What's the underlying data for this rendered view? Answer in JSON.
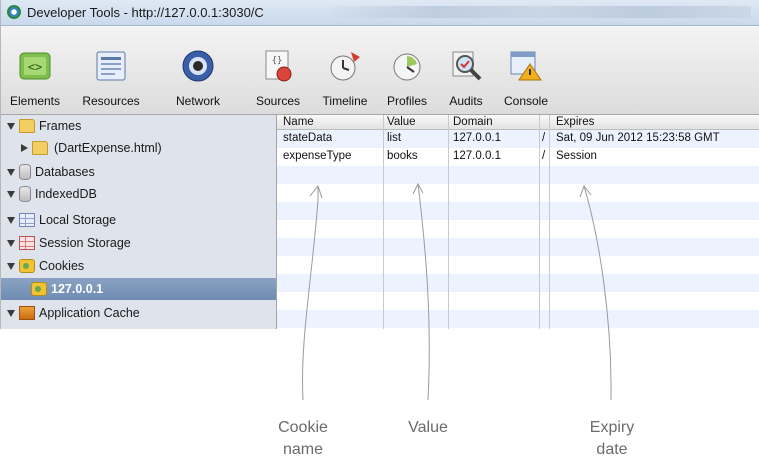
{
  "window": {
    "title": "Developer Tools - http://127.0.0.1:3030/C"
  },
  "toolbar": {
    "tabs": [
      {
        "label": "Elements",
        "icon": "elements-icon"
      },
      {
        "label": "Resources",
        "icon": "resources-icon"
      },
      {
        "label": "Network",
        "icon": "network-icon"
      },
      {
        "label": "Sources",
        "icon": "sources-icon"
      },
      {
        "label": "Timeline",
        "icon": "timeline-icon"
      },
      {
        "label": "Profiles",
        "icon": "profiles-icon"
      },
      {
        "label": "Audits",
        "icon": "audits-icon"
      },
      {
        "label": "Console",
        "icon": "console-icon"
      }
    ]
  },
  "sidebar": {
    "items": [
      {
        "label": "Frames",
        "icon": "folder-icon",
        "expanded": true
      },
      {
        "label": "(DartExpense.html)",
        "icon": "folder-icon",
        "expanded": false
      },
      {
        "label": "Databases",
        "icon": "database-icon",
        "expanded": true
      },
      {
        "label": "IndexedDB",
        "icon": "database-icon",
        "expanded": true
      },
      {
        "label": "Local Storage",
        "icon": "storage-icon",
        "expanded": true
      },
      {
        "label": "Session Storage",
        "icon": "storage-icon",
        "expanded": true
      },
      {
        "label": "Cookies",
        "icon": "cookie-icon",
        "expanded": true
      },
      {
        "label": "127.0.0.1",
        "icon": "cookie-icon",
        "selected": true
      },
      {
        "label": "Application Cache",
        "icon": "cache-icon",
        "expanded": true
      }
    ]
  },
  "table": {
    "columns": [
      "Name",
      "Value",
      "Domain",
      "Expires"
    ],
    "rows": [
      {
        "name": "stateData",
        "value": "list",
        "domain": "127.0.0.1",
        "path": "/",
        "expires": "Sat, 09 Jun 2012 15:23:58 GMT"
      },
      {
        "name": "expenseType",
        "value": "books",
        "domain": "127.0.0.1",
        "path": "/",
        "expires": "Session"
      }
    ]
  },
  "annotations": {
    "cookie_name": "Cookie\nname",
    "value": "Value",
    "expiry_date": "Expiry\ndate"
  }
}
